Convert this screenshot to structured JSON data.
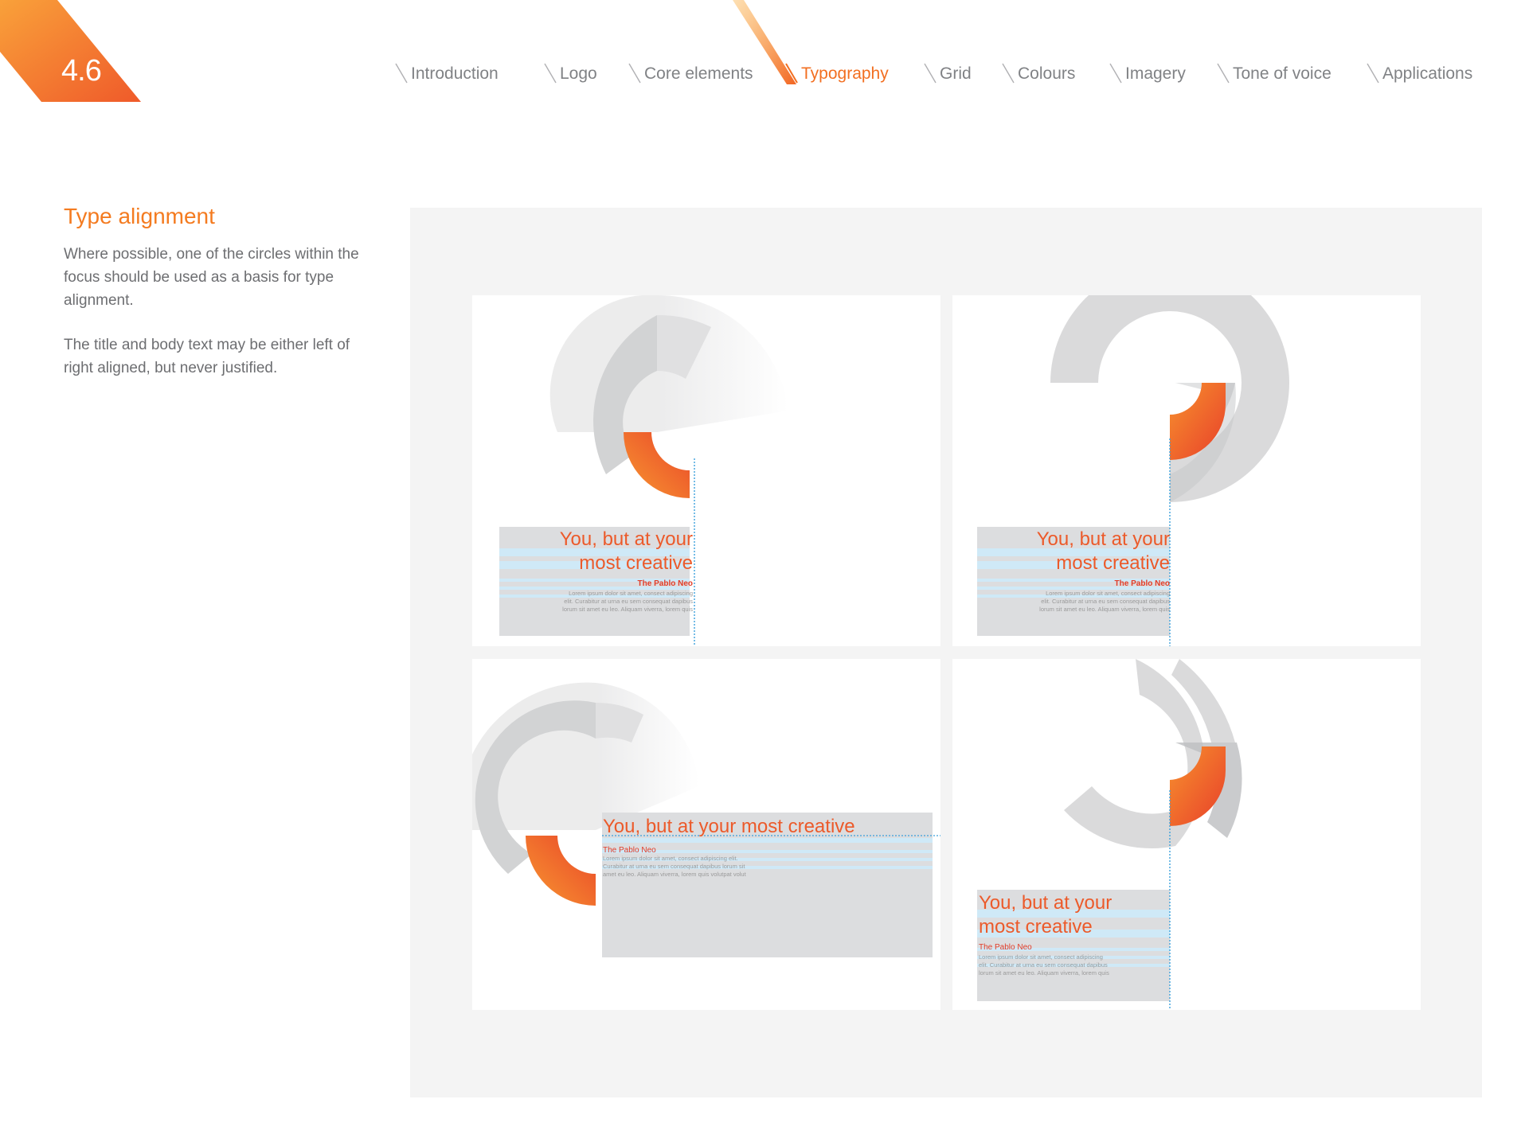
{
  "page": {
    "number": "4.6"
  },
  "nav": {
    "items": [
      {
        "label": "Introduction"
      },
      {
        "label": "Logo"
      },
      {
        "label": "Core elements"
      },
      {
        "label": "Typography",
        "active": true
      },
      {
        "label": "Grid"
      },
      {
        "label": "Colours"
      },
      {
        "label": "Imagery"
      },
      {
        "label": "Tone of voice"
      },
      {
        "label": "Applications"
      }
    ]
  },
  "section": {
    "title": "Type alignment",
    "paragraphs": [
      "Where possible, one of the circles within the focus should be used as a basis for type alignment.",
      "The title and body text may be either left of right aligned, but never justified."
    ]
  },
  "examples": [
    {
      "headline_lines": [
        "You, but at your",
        "most creative"
      ],
      "byline": "The Pablo Neo",
      "body_lines": [
        "Lorem ipsum dolor sit amet, consect adipiscing",
        "elit. Curabitur at urna eu sem consequat dapibus",
        "lorum sit amet eu leo. Aliquam viverra, lorem quis"
      ]
    },
    {
      "headline_lines": [
        "You, but at your",
        "most creative"
      ],
      "byline": "The Pablo Neo",
      "body_lines": [
        "Lorem ipsum dolor sit amet, consect adipiscing",
        "elit. Curabitur at urna eu sem consequat dapibus",
        "lorum sit amet eu leo. Aliquam viverra, lorem quis"
      ]
    },
    {
      "headline": "You, but at your most creative",
      "byline": "The Pablo Neo",
      "body_lines": [
        "Lorem ipsum dolor sit amet, consect adipiscing elit.",
        "Curabitur at urna eu sem consequat dapibus lorum sit",
        "amet eu leo. Aliquam viverra, lorem quis volutpat volut"
      ]
    },
    {
      "headline_lines": [
        "You, but at your",
        "most creative"
      ],
      "byline": "The Pablo Neo",
      "body_lines": [
        "Lorem ipsum dolor sit amet, consect adipiscing",
        "elit. Curabitur at urna eu sem consequat dapibus",
        "lorum sit amet eu leo. Aliquam viverra, lorem quis"
      ]
    }
  ],
  "colors": {
    "brand_orange": "#f47b20",
    "brand_red": "#e9452a",
    "guide_blue": "#3aa0dc",
    "nav_grey": "#808285"
  }
}
